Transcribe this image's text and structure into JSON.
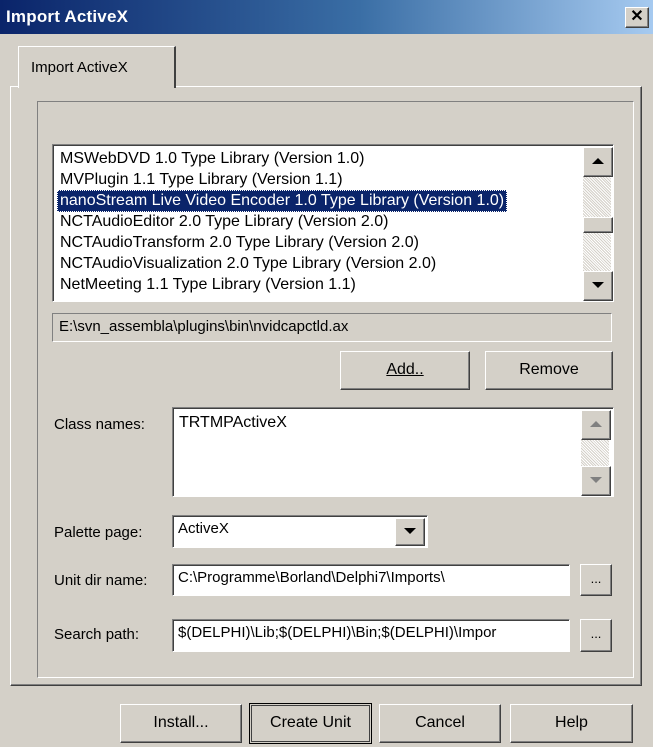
{
  "window": {
    "title": "Import ActiveX",
    "close_glyph": "✕"
  },
  "tabs": [
    {
      "label": "Import ActiveX"
    }
  ],
  "library_list": {
    "items": [
      "MSWebDVD 1.0 Type Library (Version 1.0)",
      "MVPlugin 1.1 Type Library (Version 1.1)",
      "nanoStream Live Video Encoder 1.0 Type Library (Version 1.0)",
      "NCTAudioEditor 2.0 Type Library (Version 2.0)",
      "NCTAudioTransform 2.0 Type Library (Version 2.0)",
      "NCTAudioVisualization 2.0 Type Library (Version 2.0)",
      "NetMeeting 1.1 Type Library (Version 1.1)"
    ],
    "selected_item": "nanoStream Live Video Encoder 1.0 Type Library (Version 1.0)"
  },
  "file_path": "E:\\svn_assembla\\plugins\\bin\\nvidcapctld.ax",
  "buttons": {
    "add": "Add..",
    "remove": "Remove",
    "install": "Install...",
    "create_unit": "Create Unit",
    "cancel": "Cancel",
    "help": "Help",
    "browse": "..."
  },
  "class_names": {
    "label": "Class names:",
    "value": "TRTMPActiveX"
  },
  "palette_page": {
    "label": "Palette page:",
    "value": "ActiveX"
  },
  "unit_dir": {
    "label": "Unit dir name:",
    "value": "C:\\Programme\\Borland\\Delphi7\\Imports\\"
  },
  "search_path": {
    "label": "Search path:",
    "value": "$(DELPHI)\\Lib;$(DELPHI)\\Bin;$(DELPHI)\\Impor"
  },
  "colors": {
    "title_start": "#0a246a",
    "title_end": "#a6caf0",
    "selection": "#0a246a",
    "face": "#d4d0c8"
  },
  "icons": {
    "scroll_up": "triangle-up",
    "scroll_down": "triangle-down",
    "dropdown": "triangle-down"
  }
}
